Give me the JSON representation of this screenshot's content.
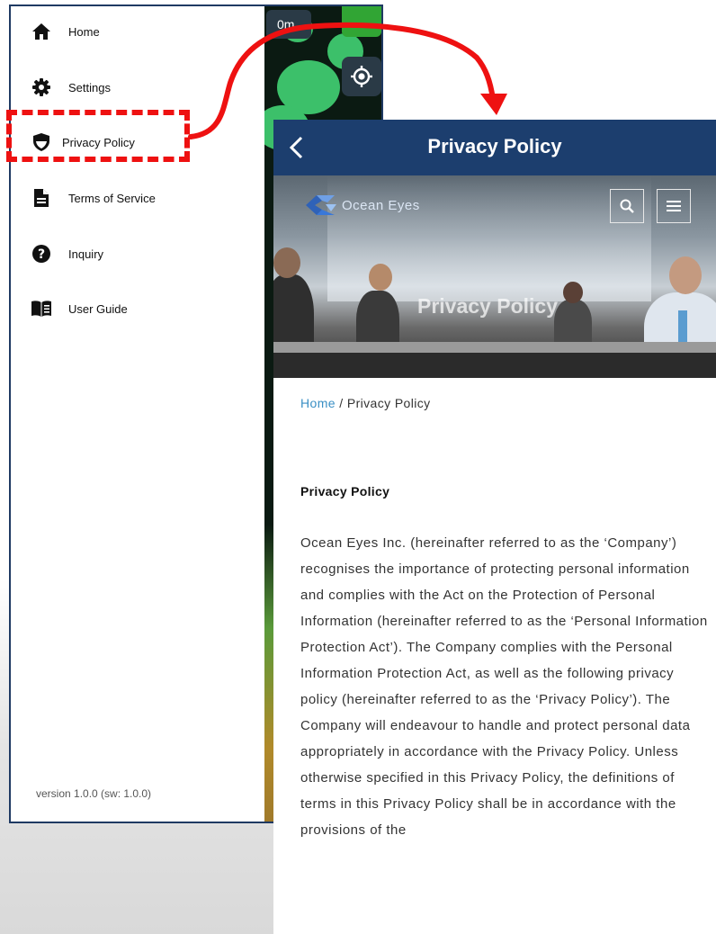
{
  "left_screen": {
    "map": {
      "distance_label": "0m"
    },
    "menu": [
      {
        "label": "Home",
        "icon": "home-icon"
      },
      {
        "label": "Settings",
        "icon": "gear-icon"
      },
      {
        "label": "Privacy Policy",
        "icon": "shield-icon"
      },
      {
        "label": "Terms of Service",
        "icon": "document-icon"
      },
      {
        "label": "Inquiry",
        "icon": "question-icon"
      },
      {
        "label": "User Guide",
        "icon": "book-icon"
      }
    ],
    "version": "version 1.0.0 (sw:  1.0.0)"
  },
  "right_screen": {
    "appbar_title": "Privacy Policy",
    "logo_text": "Ocean Eyes",
    "hero_title": "Privacy Policy",
    "breadcrumb": {
      "home": "Home",
      "separator": " / ",
      "current": "Privacy Policy"
    },
    "section_title": "Privacy Policy",
    "body": "Ocean Eyes Inc. (hereinafter referred to as the ‘Company’) recognises the importance of protecting personal information and complies with the Act on the Protection of Personal Information (hereinafter referred to as the ‘Personal Information Protection Act’). The Company complies with the Personal Information Protection Act, as well as the following privacy policy (hereinafter referred to as the ‘Privacy Policy’). The Company will endeavour to handle and protect personal data appropriately in accordance with the Privacy Policy. Unless otherwise specified in this Privacy Policy, the definitions of terms in this Privacy Policy shall be in accordance with the provisions of the"
  },
  "colors": {
    "highlight": "#e11111",
    "appbar": "#1c3e6e",
    "breadcrumb_link": "#3a8fc4"
  }
}
